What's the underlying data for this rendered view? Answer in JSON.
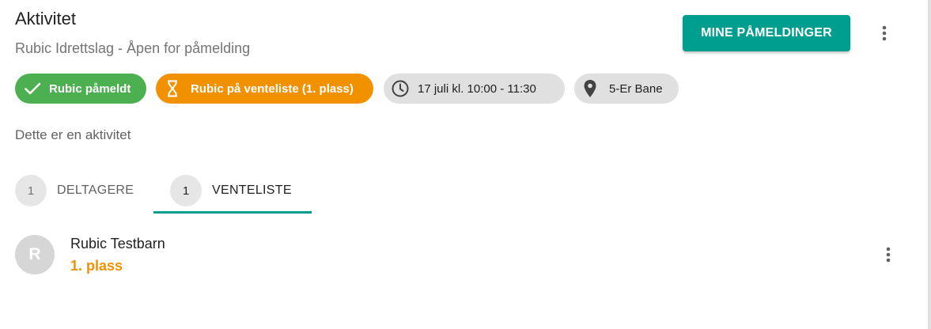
{
  "header": {
    "title": "Aktivitet",
    "subtitle": "Rubic Idrettslag - Åpen for påmelding",
    "primary_button_label": "MINE PÅMELDINGER"
  },
  "chips": [
    {
      "label": "Rubic påmeldt",
      "icon": "check-icon",
      "color": "#4caf50"
    },
    {
      "label": "Rubic på venteliste (1. plass)",
      "icon": "hourglass-icon",
      "color": "#f29100"
    },
    {
      "label": "17 juli kl. 10:00 - 11:30",
      "icon": "clock-icon",
      "color": "#e0e0e0"
    },
    {
      "label": "5-Er Bane",
      "icon": "location-pin-icon",
      "color": "#e0e0e0"
    }
  ],
  "description": "Dette er en aktivitet",
  "tabs": [
    {
      "count": "1",
      "label": "DELTAGERE",
      "active": false
    },
    {
      "count": "1",
      "label": "VENTELISTE",
      "active": true
    }
  ],
  "waitlist": [
    {
      "initial": "R",
      "name": "Rubic Testbarn",
      "place": "1. plass"
    }
  ],
  "colors": {
    "accent": "#009e8e",
    "success": "#4caf50",
    "warning": "#f29100"
  }
}
